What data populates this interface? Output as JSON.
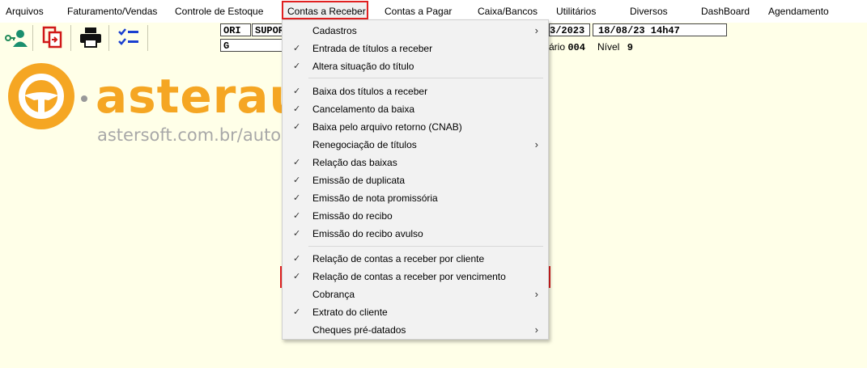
{
  "menubar": {
    "items": [
      "Arquivos",
      "Faturamento/Vendas",
      "Controle de Estoque",
      "Contas a Receber",
      "Contas a Pagar",
      "Caixa/Bancos",
      "Utilitários",
      "Diversos",
      "DashBoard",
      "Agendamento"
    ],
    "active": "Contas a Receber"
  },
  "fields": {
    "code": "ORI",
    "user": "SUPOR",
    "g": "G",
    "date": "3/2023",
    "datetime": "18/08/23 14h47"
  },
  "info": {
    "user_label": "ário",
    "user_value": "004",
    "level_label": "Nível",
    "level_value": "9"
  },
  "logo": {
    "brand": "asteraut",
    "url": "astersoft.com.br/auto"
  },
  "dropdown": {
    "items": [
      {
        "label": "Cadastros",
        "check": false,
        "submenu": true
      },
      {
        "label": "Entrada de títulos a receber",
        "check": true,
        "submenu": false
      },
      {
        "label": "Altera situação do título",
        "check": true,
        "submenu": false
      },
      {
        "label": "Baixa dos títulos a receber",
        "check": true,
        "submenu": false
      },
      {
        "label": "Cancelamento da baixa",
        "check": true,
        "submenu": false
      },
      {
        "label": "Baixa pelo arquivo retorno (CNAB)",
        "check": true,
        "submenu": false
      },
      {
        "label": "Renegociação de títulos",
        "check": false,
        "submenu": true
      },
      {
        "label": "Relação das baixas",
        "check": true,
        "submenu": false
      },
      {
        "label": "Emissão de duplicata",
        "check": true,
        "submenu": false
      },
      {
        "label": "Emissão de nota promissória",
        "check": true,
        "submenu": false
      },
      {
        "label": "Emissão do recibo",
        "check": true,
        "submenu": false
      },
      {
        "label": "Emissão do recibo avulso",
        "check": true,
        "submenu": false
      },
      {
        "label": "Relação de contas a receber por cliente",
        "check": true,
        "submenu": false
      },
      {
        "label": "Relação de contas a receber por vencimento",
        "check": true,
        "submenu": false,
        "highlighted": true
      },
      {
        "label": "Cobrança",
        "check": false,
        "submenu": true
      },
      {
        "label": "Extrato do cliente",
        "check": true,
        "submenu": false
      },
      {
        "label": "Cheques pré-datados",
        "check": false,
        "submenu": true
      }
    ],
    "check_glyph": "✓",
    "arrow_glyph": "›"
  },
  "colors": {
    "accent": "#e02020",
    "logo": "#f5a623",
    "background": "#ffffe8"
  }
}
